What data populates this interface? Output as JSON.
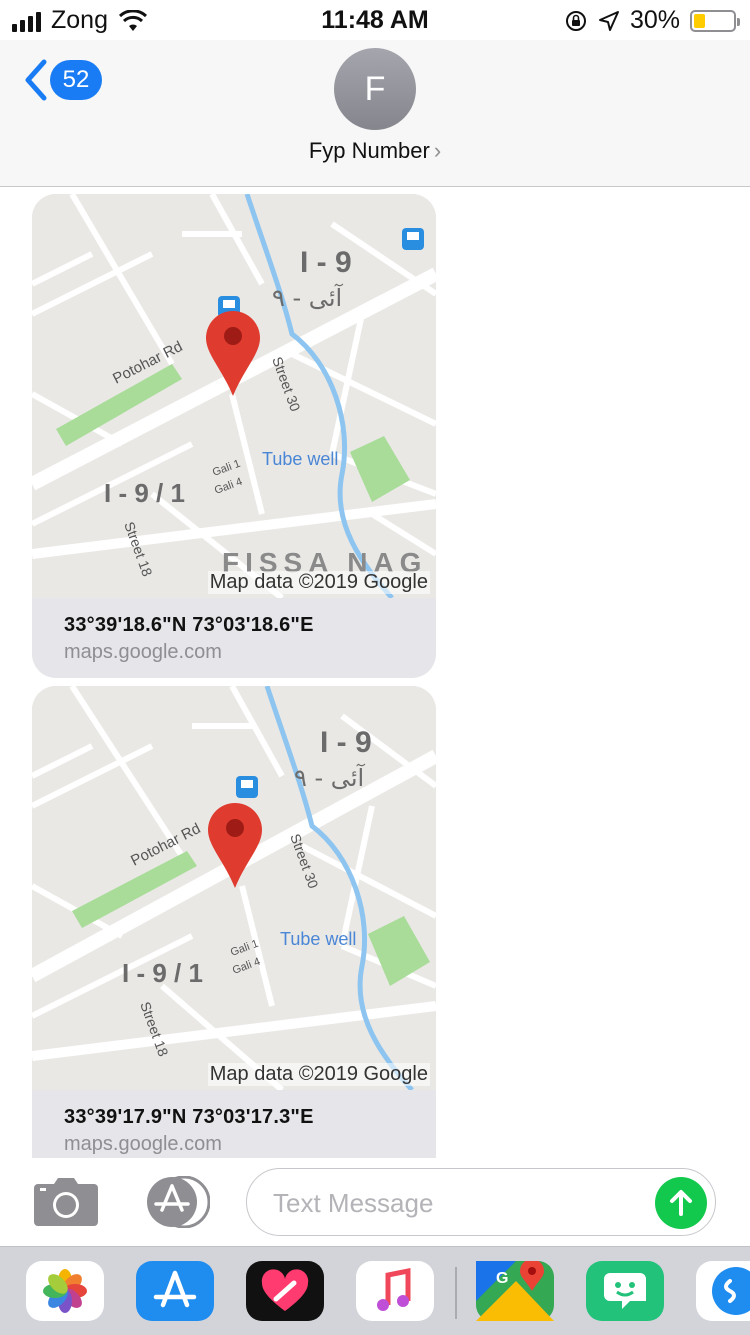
{
  "status_bar": {
    "carrier": "Zong",
    "time": "11:48 AM",
    "battery_pct": "30%",
    "battery_level": 0.3
  },
  "header": {
    "back_badge": "52",
    "avatar_initial": "F",
    "contact_name": "Fyp Number",
    "contact_chevron": "›"
  },
  "messages": [
    {
      "map": {
        "sector_label": "I - 9",
        "urdu_label": "آئی - ٩",
        "road_label": "Potohar Rd",
        "street_a": "Street 30",
        "street_b": "Street 18",
        "poi": "Tube well",
        "gali_1": "Gali 1",
        "gali_4": "Gali 4",
        "subsector": "I - 9 / 1",
        "area_partial": "FISSA NAG",
        "credit": "Map data ©2019 Google"
      },
      "coords": "33°39'18.6\"N 73°03'18.6\"E",
      "domain": "maps.google.com"
    },
    {
      "map": {
        "sector_label": "I - 9",
        "urdu_label": "آئی - ٩",
        "road_label": "Potohar Rd",
        "street_a": "Street 30",
        "street_b": "Street 18",
        "poi": "Tube well",
        "gali_1": "Gali 1",
        "gali_4": "Gali 4",
        "subsector": "I - 9 / 1",
        "credit": "Map data ©2019 Google"
      },
      "coords": "33°39'17.9\"N 73°03'17.3\"E",
      "domain": "maps.google.com"
    }
  ],
  "input": {
    "placeholder": "Text Message"
  },
  "icons": {
    "camera": "camera-icon",
    "apps": "app-store-icon",
    "send": "send-arrow-icon",
    "pin": "map-pin-icon"
  },
  "dock": {
    "apps": [
      "photos-icon",
      "app-store-icon",
      "heart-app-icon",
      "music-icon",
      "google-maps-icon",
      "bitmoji-icon",
      "shazam-icon"
    ]
  },
  "colors": {
    "accent": "#1a7cf5",
    "send": "#13c94d",
    "pin": "#e03b2f",
    "water": "#8ec5f0",
    "park": "#a8dc98"
  }
}
